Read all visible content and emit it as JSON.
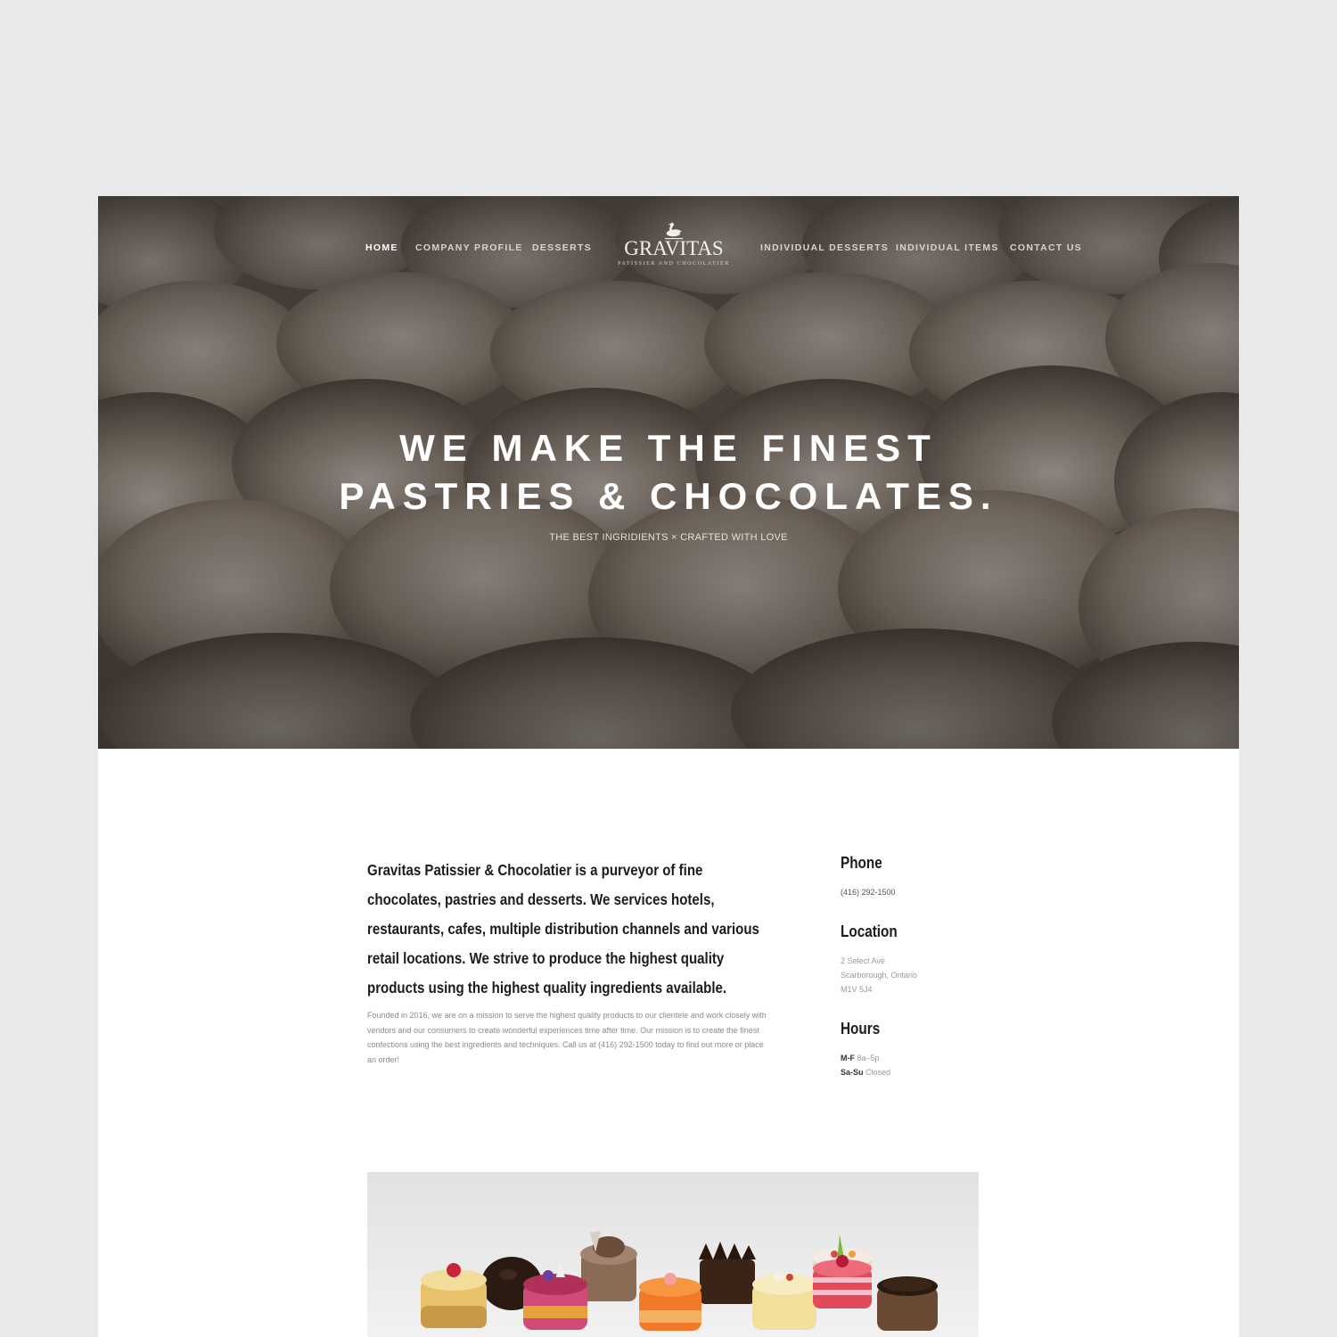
{
  "nav": {
    "home": "HOME",
    "company_profile": "COMPANY PROFILE",
    "desserts": "DESSERTS",
    "individual_desserts": "INDIVIDUAL DESSERTS",
    "individual_items": "INDIVIDUAL ITEMS",
    "contact_us": "CONTACT US"
  },
  "logo": {
    "name": "GRAVITAS",
    "tagline": "PATISSIER AND CHOCOLATIER",
    "icon": "swan-icon"
  },
  "hero": {
    "title_line1": "WE MAKE THE FINEST",
    "title_line2": "PASTRIES & CHOCOLATES.",
    "subtitle": "THE BEST INGRIDIENTS × CRAFTED WITH LOVE"
  },
  "about": {
    "lead": "Gravitas Patissier & Chocolatier is a purveyor of fine chocolates, pastries and desserts. We services hotels, restaurants, cafes, multiple distribution channels and various retail locations. We strive to produce the highest quality products using the highest quality ingredients available.",
    "body": "Founded in 2016, we are on a mission to serve the highest quality products to our clientele and work closely with vendors and our consumers to create wonderful experiences time after time. Our mission is to create the finest confections using the best ingredients and techniques. Call us at (416) 292-1500 today to find out more or place an order!"
  },
  "info": {
    "phone_heading": "Phone",
    "phone": "(416) 292-1500",
    "location_heading": "Location",
    "address_line1": "2 Select Ave",
    "address_line2": "Scarborough, Ontario",
    "address_line3": "M1V 5J4",
    "hours_heading": "Hours",
    "hours_weekday_label": "M-F",
    "hours_weekday": "8a–5p",
    "hours_weekend_label": "Sa-Su",
    "hours_weekend": "Closed"
  },
  "colors": {
    "page_background": "#e9e9e9",
    "hero_overlay": "#3a3632",
    "heading_text": "#1c1c1c",
    "muted_text": "#8b8b8b"
  }
}
